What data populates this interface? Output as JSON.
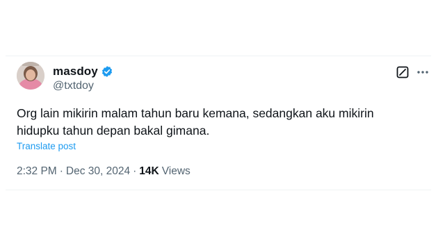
{
  "author": {
    "display_name": "masdoy",
    "handle": "@txtdoy",
    "verified": true
  },
  "tweet": {
    "text": "Org lain mikirin malam tahun baru kemana, sedangkan aku mikirin\nhidupku tahun depan bakal gimana.",
    "translate_label": "Translate post",
    "time": "2:32 PM",
    "separator": "·",
    "date": "Dec 30, 2024",
    "views_count": "14K",
    "views_label": "Views"
  },
  "icons": {
    "verified": "verified-badge-icon",
    "grok": "grok-icon",
    "more": "more-icon"
  },
  "colors": {
    "text_primary": "#0f1419",
    "text_secondary": "#536471",
    "link": "#1d9bf0",
    "verified": "#1d9bf0"
  }
}
